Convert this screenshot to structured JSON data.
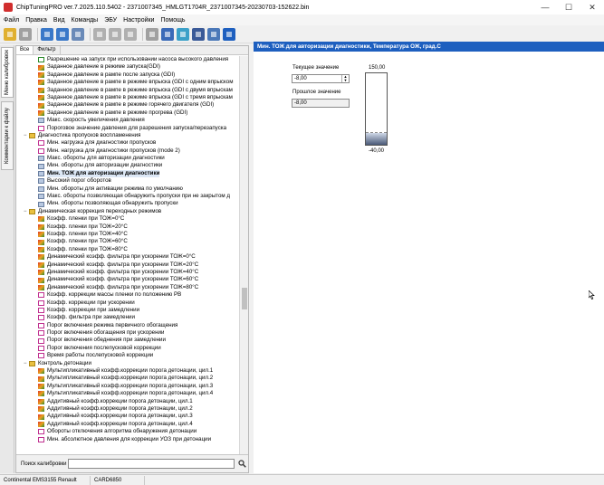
{
  "window": {
    "title": "ChipTuningPRO ver.7.2025.110.5402 - 2371007345_HMLGT1704R_2371007345-20230703-152622.bin",
    "minimize_glyph": "—",
    "maximize_glyph": "☐",
    "close_glyph": "✕"
  },
  "menu": {
    "items": [
      "Файл",
      "Правка",
      "Вид",
      "Команды",
      "ЭБУ",
      "Настройки",
      "Помощь"
    ]
  },
  "toolbar": {
    "buttons": [
      {
        "icon": "open-folder-icon",
        "color": "#e0b030"
      },
      {
        "icon": "open-dropdown-icon",
        "color": "#a0a0a0"
      },
      {
        "icon": "save-icon",
        "color": "#3a78c8"
      },
      {
        "icon": "save-as-icon",
        "color": "#3a78c8"
      },
      {
        "icon": "compare-icon",
        "color": "#6a8ab8"
      },
      {
        "icon": "undo-icon",
        "color": "#b0b0b0"
      },
      {
        "icon": "redo-icon",
        "color": "#b0b0b0"
      },
      {
        "icon": "copy-icon",
        "color": "#b0b0b0"
      },
      {
        "icon": "tool-icon",
        "color": "#a0a0a0"
      },
      {
        "icon": "checksum-icon",
        "color": "#3a6ab8"
      },
      {
        "icon": "connect-icon",
        "color": "#3aa0c8"
      },
      {
        "icon": "calibrate-icon",
        "color": "#3a5a98"
      },
      {
        "icon": "settings-icon",
        "color": "#4a78b8"
      },
      {
        "icon": "info-icon",
        "color": "#1d5fbf"
      }
    ]
  },
  "sidebar": {
    "tabs": [
      "Меню калибровок",
      "Комментарии к файлу"
    ]
  },
  "left_panel": {
    "tabs": [
      "Все",
      "Фильтр"
    ],
    "tree": [
      {
        "indent": 2,
        "icon": "check",
        "label": "Разрешение на запуск при использовании насоса высокого давления"
      },
      {
        "indent": 2,
        "icon": "map",
        "label": "Заданное давление в режиме запуска(GDI)"
      },
      {
        "indent": 2,
        "icon": "map",
        "label": "Заданное давление в рампе после запуска (GDI)"
      },
      {
        "indent": 2,
        "icon": "map",
        "label": "Заданное давление в рампе в режиме впрыска (GDI с одним впрыском"
      },
      {
        "indent": 2,
        "icon": "map",
        "label": "Заданное давление в рампе в режиме впрыска (GDI с двумя впрыскам"
      },
      {
        "indent": 2,
        "icon": "map",
        "label": "Заданное давление в рампе в режиме впрыска (GDI с тремя впрыскам"
      },
      {
        "indent": 2,
        "icon": "map",
        "label": "Заданное давление в рампе в режиме горячего двигателя (GDI)"
      },
      {
        "indent": 2,
        "icon": "map",
        "label": "Заданное давление в рампе в режиме прогрева (GDI)"
      },
      {
        "indent": 2,
        "icon": "const",
        "label": "Макс. скорость увеличения давления"
      },
      {
        "indent": 2,
        "icon": "curve",
        "label": "Пороговое значение давления для разрешения запуска/перезапуска"
      },
      {
        "indent": 1,
        "icon": "folder",
        "label": "Диагностика пропусков воспламенения",
        "twisty": "−"
      },
      {
        "indent": 2,
        "icon": "curve",
        "label": "Мин. нагрузка для диагностики пропусков"
      },
      {
        "indent": 2,
        "icon": "curve",
        "label": "Мин. нагрузка для диагностики пропусков (mode 2)"
      },
      {
        "indent": 2,
        "icon": "const",
        "label": "Макс. обороты для авторизации диагностики"
      },
      {
        "indent": 2,
        "icon": "const",
        "label": "Мин. обороты для авторизации диагностики"
      },
      {
        "indent": 2,
        "icon": "const",
        "label": "Мин. ТОЖ для авторизации диагностики",
        "selected": true
      },
      {
        "indent": 2,
        "icon": "const",
        "label": "Высокий порог оборотов"
      },
      {
        "indent": 2,
        "icon": "const",
        "label": "Мин. обороты для активации режима по умолчанию"
      },
      {
        "indent": 2,
        "icon": "const",
        "label": "Макс. обороты позволяющая обнаружить пропуски при не закрытом д"
      },
      {
        "indent": 2,
        "icon": "const",
        "label": "Мин. обороты позволяющая обнаружить пропуски"
      },
      {
        "indent": 1,
        "icon": "folder",
        "label": "Динамическая коррекция переходных режимов",
        "twisty": "−"
      },
      {
        "indent": 2,
        "icon": "map",
        "label": "Коэфф. пленки при ТОЖ=0°C"
      },
      {
        "indent": 2,
        "icon": "map",
        "label": "Коэфф. пленки при ТОЖ=20°C"
      },
      {
        "indent": 2,
        "icon": "map",
        "label": "Коэфф. пленки при ТОЖ=40°C"
      },
      {
        "indent": 2,
        "icon": "map",
        "label": "Коэфф. пленки при ТОЖ=60°C"
      },
      {
        "indent": 2,
        "icon": "map",
        "label": "Коэфф. пленки при ТОЖ=80°C"
      },
      {
        "indent": 2,
        "icon": "map",
        "label": "Динамический коэфф. фильтра при ускорении ТОЖ=0°C"
      },
      {
        "indent": 2,
        "icon": "map",
        "label": "Динамический коэфф. фильтра при ускорении ТОЖ=20°C"
      },
      {
        "indent": 2,
        "icon": "map",
        "label": "Динамический коэфф. фильтра при ускорении ТОЖ=40°C"
      },
      {
        "indent": 2,
        "icon": "map",
        "label": "Динамический коэфф. фильтра при ускорении ТОЖ=60°C"
      },
      {
        "indent": 2,
        "icon": "map",
        "label": "Динамический коэфф. фильтра при ускорении ТОЖ=80°C"
      },
      {
        "indent": 2,
        "icon": "curve",
        "label": "Коэфф. коррекции массы пленки по положению РВ"
      },
      {
        "indent": 2,
        "icon": "curve",
        "label": "Коэфф. коррекции при ускорении"
      },
      {
        "indent": 2,
        "icon": "curve",
        "label": "Коэфф. коррекции при замедлении"
      },
      {
        "indent": 2,
        "icon": "curve",
        "label": "Коэфф. фильтра при замедлении"
      },
      {
        "indent": 2,
        "icon": "curve",
        "label": "Порог включения режима первичного обогащения"
      },
      {
        "indent": 2,
        "icon": "curve",
        "label": "Порог включения обогащения при ускорении"
      },
      {
        "indent": 2,
        "icon": "curve",
        "label": "Порог включения обеднения при замедлении"
      },
      {
        "indent": 2,
        "icon": "curve",
        "label": "Порог включения послепусковой коррекции"
      },
      {
        "indent": 2,
        "icon": "curve",
        "label": "Время работы послепусковой коррекции"
      },
      {
        "indent": 1,
        "icon": "folder",
        "label": "Контроль детонации",
        "twisty": "−"
      },
      {
        "indent": 2,
        "icon": "map",
        "label": "Мультипликативный коэфф.коррекции порога детонации, цил.1"
      },
      {
        "indent": 2,
        "icon": "map",
        "label": "Мультипликативный коэфф.коррекции порога детонации, цил.2"
      },
      {
        "indent": 2,
        "icon": "map",
        "label": "Мультипликативный коэфф.коррекции порога детонации, цил.3"
      },
      {
        "indent": 2,
        "icon": "map",
        "label": "Мультипликативный коэфф.коррекции порога детонации, цил.4"
      },
      {
        "indent": 2,
        "icon": "map",
        "label": "Аддитивный коэфф.коррекции порога детонации, цил.1"
      },
      {
        "indent": 2,
        "icon": "map",
        "label": "Аддитивный коэфф.коррекции порога детонации, цил.2"
      },
      {
        "indent": 2,
        "icon": "map",
        "label": "Аддитивный коэфф.коррекции порога детонации, цил.3"
      },
      {
        "indent": 2,
        "icon": "map",
        "label": "Аддитивный коэфф.коррекции порога детонации, цил.4"
      },
      {
        "indent": 2,
        "icon": "curve",
        "label": "Обороты отключения алгоритма обнаружения детонации"
      },
      {
        "indent": 2,
        "icon": "curve",
        "label": "Мин. абсолютное давления для коррекции УОЗ при детонации"
      }
    ],
    "search_label": "Поиск калибровки",
    "search_value": ""
  },
  "right_panel": {
    "title": "Мин. ТОЖ для авторизации диагностики, Температура ОЖ, град.С",
    "current_label": "Текущее значение",
    "current_value": "-8,00",
    "previous_label": "Прошлое значение",
    "previous_value": "-8,00",
    "gauge_max": "150,00",
    "gauge_min": "-40,00",
    "gauge_fill_fraction": 0.17
  },
  "statusbar": {
    "ecu": "Continental EMS3155 Renault",
    "card": "CARD6850"
  }
}
